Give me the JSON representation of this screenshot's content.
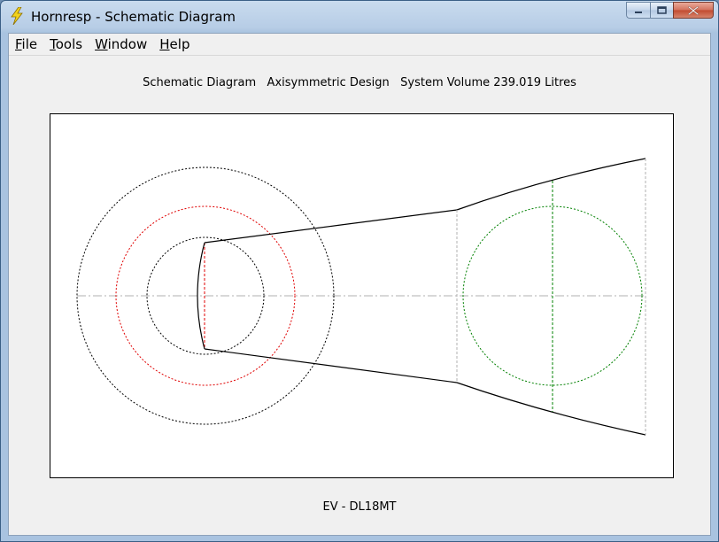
{
  "window": {
    "title": "Hornresp - Schematic Diagram",
    "app_icon": "lightning-bolt-icon",
    "buttons": [
      "minimize-icon",
      "maximize-icon",
      "close-icon"
    ]
  },
  "menu": {
    "items": [
      {
        "label": "File",
        "access_key": "F"
      },
      {
        "label": "Tools",
        "access_key": "T"
      },
      {
        "label": "Window",
        "access_key": "W"
      },
      {
        "label": "Help",
        "access_key": "H"
      }
    ]
  },
  "diagram": {
    "heading": "Schematic Diagram   Axisymmetric Design   System Volume 239.019 Litres",
    "caption": "EV - DL18MT",
    "colors": {
      "outline": "#000000",
      "axis": "#b0b0b0",
      "driver_circle_outer": "#000000",
      "driver_circle_middle": "#e00000",
      "driver_circle_inner": "#000000",
      "mouth_circle": "#008000"
    }
  }
}
